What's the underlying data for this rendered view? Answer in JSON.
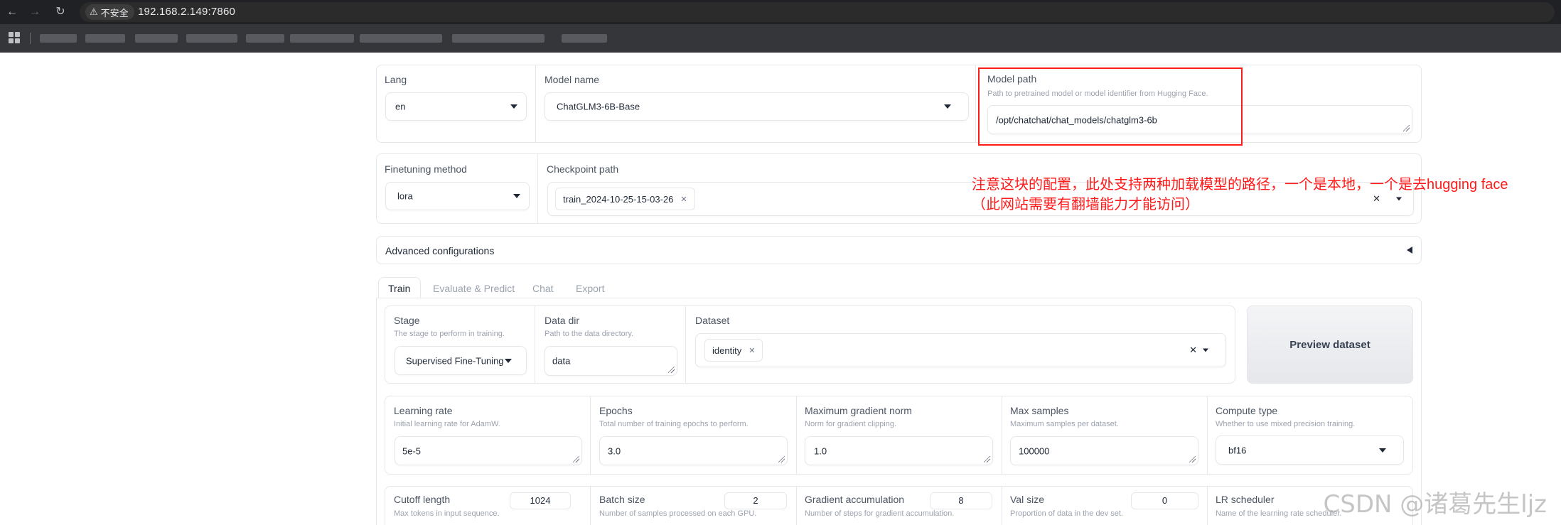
{
  "browser": {
    "security_label": "不安全",
    "url": "192.168.2.149:7860"
  },
  "top": {
    "lang": {
      "label": "Lang",
      "value": "en"
    },
    "model_name": {
      "label": "Model name",
      "value": "ChatGLM3-6B-Base"
    },
    "model_path": {
      "label": "Model path",
      "info": "Path to pretrained model or model identifier from Hugging Face.",
      "value": "/opt/chatchat/chat_models/chatglm3-6b"
    }
  },
  "finetune": {
    "method": {
      "label": "Finetuning method",
      "value": "lora"
    },
    "checkpoint": {
      "label": "Checkpoint path",
      "tag": "train_2024-10-25-15-03-26",
      "clear": "✕"
    }
  },
  "advanced": {
    "label": "Advanced configurations"
  },
  "tabs": [
    {
      "label": "Train"
    },
    {
      "label": "Evaluate & Predict"
    },
    {
      "label": "Chat"
    },
    {
      "label": "Export"
    }
  ],
  "train": {
    "stage": {
      "label": "Stage",
      "info": "The stage to perform in training.",
      "value": "Supervised Fine-Tuning"
    },
    "data_dir": {
      "label": "Data dir",
      "info": "Path to the data directory.",
      "value": "data"
    },
    "dataset": {
      "label": "Dataset",
      "tag": "identity",
      "clear": "✕"
    },
    "preview_button": "Preview dataset",
    "learning_rate": {
      "label": "Learning rate",
      "info": "Initial learning rate for AdamW.",
      "value": "5e-5"
    },
    "epochs": {
      "label": "Epochs",
      "info": "Total number of training epochs to perform.",
      "value": "3.0"
    },
    "max_grad_norm": {
      "label": "Maximum gradient norm",
      "info": "Norm for gradient clipping.",
      "value": "1.0"
    },
    "max_samples": {
      "label": "Max samples",
      "info": "Maximum samples per dataset.",
      "value": "100000"
    },
    "compute_type": {
      "label": "Compute type",
      "info": "Whether to use mixed precision training.",
      "value": "bf16"
    },
    "cutoff_length": {
      "label": "Cutoff length",
      "info": "Max tokens in input sequence.",
      "value": "1024"
    },
    "batch_size": {
      "label": "Batch size",
      "info": "Number of samples processed on each GPU.",
      "value": "2"
    },
    "grad_accum": {
      "label": "Gradient accumulation",
      "info": "Number of steps for gradient accumulation.",
      "value": "8"
    },
    "val_size": {
      "label": "Val size",
      "info": "Proportion of data in the dev set.",
      "value": "0"
    },
    "lr_scheduler": {
      "label": "LR scheduler",
      "info": "Name of the learning rate scheduler."
    }
  },
  "annotation": {
    "line1": "注意这块的配置，此处支持两种加载模型的路径，一个是本地，一个是去hugging face",
    "line2": "（此网站需要有翻墙能力才能访问）"
  },
  "watermark": "CSDN @诸葛先生ljz"
}
